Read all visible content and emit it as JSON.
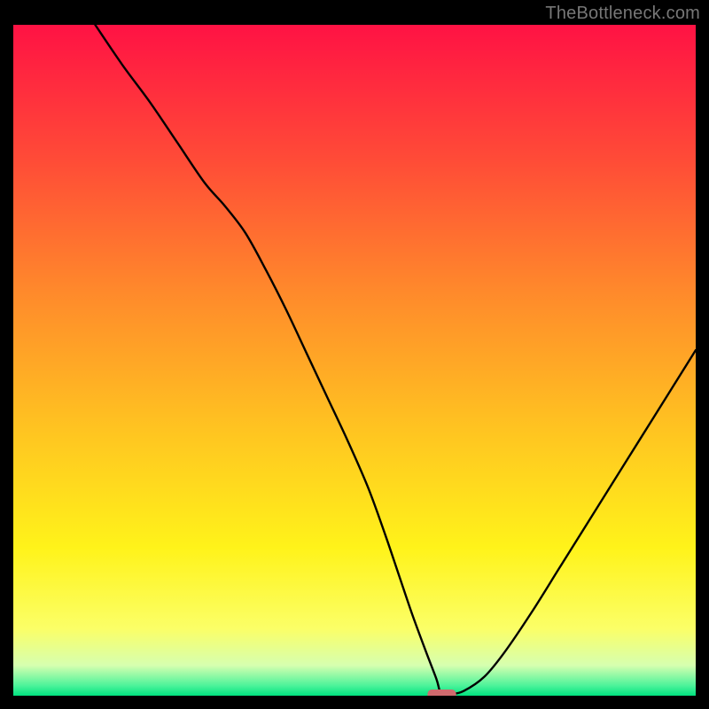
{
  "watermark": "TheBottleneck.com",
  "chart_data": {
    "type": "line",
    "title": "",
    "xlabel": "",
    "ylabel": "",
    "xlim": [
      0,
      100
    ],
    "ylim": [
      0,
      100
    ],
    "grid": false,
    "legend": false,
    "background_gradient": {
      "stops": [
        {
          "pos": 0.0,
          "color": "#ff1244"
        },
        {
          "pos": 0.2,
          "color": "#ff4b37"
        },
        {
          "pos": 0.4,
          "color": "#ff8a2b"
        },
        {
          "pos": 0.6,
          "color": "#ffc321"
        },
        {
          "pos": 0.78,
          "color": "#fff31a"
        },
        {
          "pos": 0.9,
          "color": "#fbff67"
        },
        {
          "pos": 0.955,
          "color": "#d6ffb0"
        },
        {
          "pos": 0.985,
          "color": "#4cf39a"
        },
        {
          "pos": 1.0,
          "color": "#00e27f"
        }
      ]
    },
    "series": [
      {
        "name": "bottleneck-curve",
        "color": "#000000",
        "x": [
          12,
          16,
          20,
          24,
          28,
          31,
          34,
          37,
          40,
          43,
          46,
          49,
          52,
          54.5,
          56.5,
          58.5,
          60.5,
          62,
          62.5,
          63,
          64,
          66,
          69,
          72,
          76,
          80,
          84,
          88,
          92,
          96,
          100
        ],
        "y": [
          100,
          94,
          88.5,
          82.5,
          76.5,
          73,
          69,
          63.5,
          57.5,
          51,
          44.5,
          38,
          31,
          24,
          18,
          12,
          6.5,
          2.5,
          0.7,
          0.2,
          0.2,
          0.7,
          2.8,
          6.5,
          12.5,
          19,
          25.5,
          32,
          38.5,
          45,
          51.5
        ]
      }
    ],
    "optimum_marker": {
      "x": 62.8,
      "y": 0.0,
      "width_pct": 4.2,
      "color": "#d06a6e"
    }
  }
}
